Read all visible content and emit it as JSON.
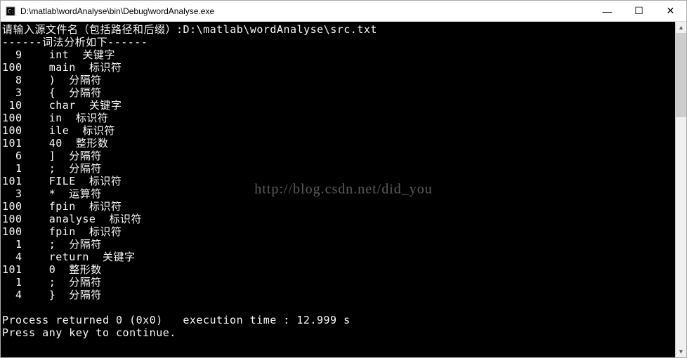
{
  "window": {
    "title": "D:\\matlab\\wordAnalyse\\bin\\Debug\\wordAnalyse.exe"
  },
  "console": {
    "prompt_line": "请输入源文件名（包括路径和后缀）:D:\\matlab\\wordAnalyse\\src.txt",
    "header_line": "------词法分析如下------",
    "rows": [
      {
        "code": "  9",
        "token": "int",
        "type": "关键字"
      },
      {
        "code": "100",
        "token": "main",
        "type": "标识符"
      },
      {
        "code": "  8",
        "token": ")",
        "type": "分隔符"
      },
      {
        "code": "  3",
        "token": "{",
        "type": "分隔符"
      },
      {
        "code": " 10",
        "token": "char",
        "type": "关键字"
      },
      {
        "code": "100",
        "token": "in",
        "type": "标识符"
      },
      {
        "code": "100",
        "token": "ile",
        "type": "标识符"
      },
      {
        "code": "101",
        "token": "40",
        "type": "整形数"
      },
      {
        "code": "  6",
        "token": "]",
        "type": "分隔符"
      },
      {
        "code": "  1",
        "token": ";",
        "type": "分隔符"
      },
      {
        "code": "101",
        "token": "FILE",
        "type": "标识符"
      },
      {
        "code": "  3",
        "token": "*",
        "type": "运算符"
      },
      {
        "code": "100",
        "token": "fpin",
        "type": "标识符"
      },
      {
        "code": "100",
        "token": "analyse",
        "type": "标识符"
      },
      {
        "code": "100",
        "token": "fpin",
        "type": "标识符"
      },
      {
        "code": "  1",
        "token": ";",
        "type": "分隔符"
      },
      {
        "code": "  4",
        "token": "return",
        "type": "关键字"
      },
      {
        "code": "101",
        "token": "0",
        "type": "整形数"
      },
      {
        "code": "  1",
        "token": ";",
        "type": "分隔符"
      },
      {
        "code": "  4",
        "token": "}",
        "type": "分隔符"
      }
    ],
    "footer1": "Process returned 0 (0x0)   execution time : 12.999 s",
    "footer2": "Press any key to continue."
  },
  "watermark": "http://blog.csdn.net/did_you",
  "controls": {
    "minimize": "—",
    "maximize": "☐",
    "close": "✕"
  },
  "scroll": {
    "up": "▴",
    "down": "▾"
  }
}
